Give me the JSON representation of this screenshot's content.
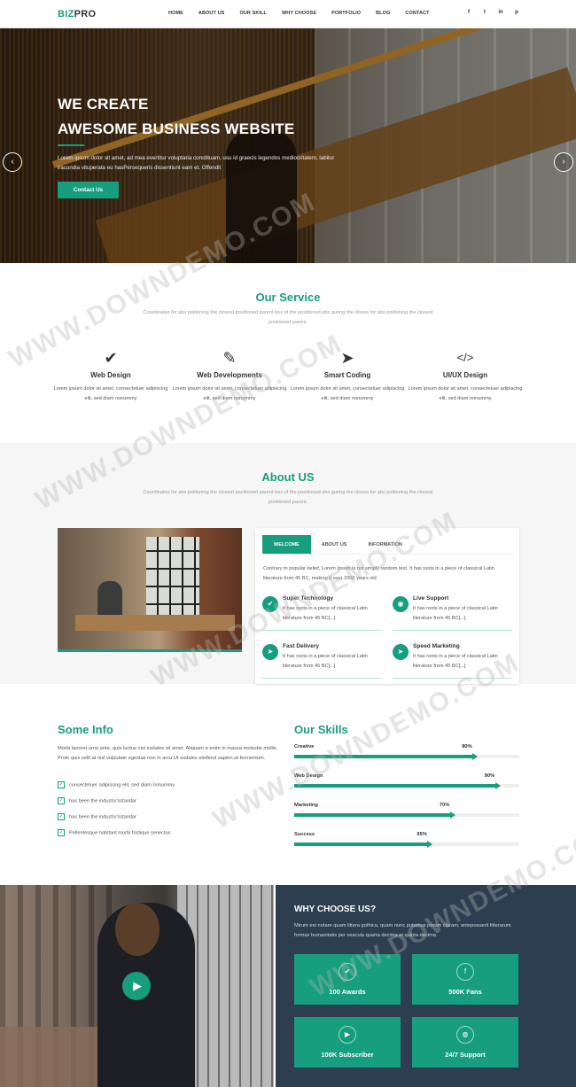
{
  "nav": {
    "logo_a": "BIZ",
    "logo_b": "PRO",
    "menu": [
      "HOME",
      "ABOUT US",
      "OUR SKILL",
      "WHY CHOOSE",
      "PORTFOLIO",
      "BLOG",
      "CONTACT"
    ],
    "social": [
      "f",
      "t",
      "in",
      "p"
    ]
  },
  "hero": {
    "line1": "WE CREATE",
    "line2": "AWESOME BUSINESS WEBSITE",
    "text": "Lorem ipsum dolor sit amet, ad mea evertitur voluptaria constituam, usu id graecis legendos mediocritatem, labitur iracundia vituperata eu hasPersequeris dissentiunt eam et. Offendit",
    "button": "Contact Us",
    "prev": "‹",
    "next": "›"
  },
  "service": {
    "title": "Our Service",
    "subtitle": "Coordinates for abs poitioning the closest positioned parent box of the positioned abs guring the closes for abs poitioning the closest positioned parent.",
    "items": [
      {
        "icon": "check-icon",
        "glyph": "✔",
        "title": "Web Design",
        "text": "Lorem ipsum dolor sit amet, consectetuer adipiscing elit, sed diam nonummy"
      },
      {
        "icon": "edit-icon",
        "glyph": "✎",
        "title": "Web Developments",
        "text": "Lorem ipsum dolor sit amet, consectetuer adipiscing elit, sed diam nonummy"
      },
      {
        "icon": "paper-plane-icon",
        "glyph": "➤",
        "title": "Smart Coding",
        "text": "Lorem ipsum dolor sit amet, consectetuer adipiscing elit, sed diam nonummy"
      },
      {
        "icon": "code-icon",
        "glyph": "</>",
        "title": "UI/UX Design",
        "text": "Lorem ipsum dolor sit amet, consectetuer adipiscing elit, sed diam nonummy"
      }
    ]
  },
  "about": {
    "title": "About US",
    "subtitle": "Coordinates for abs poitioning the closest positioned parent box of the positioned abs guring the closes for abs poitioning the closest positioned parent.",
    "tabs": [
      "WELCOME",
      "ABOUT US",
      "INFORMATION"
    ],
    "text": "Contrary to popular belief, Lorem Ipsum is not simply random text. It has roots in a piece of classical Latin literature from 45 BC, making it over 2000 years old",
    "features": [
      {
        "icon": "check-icon",
        "glyph": "✔",
        "title": "Super Technology",
        "text": "It has roots in a piece of classical Latin literature from 45 BC[...]"
      },
      {
        "icon": "support-icon",
        "glyph": "◉",
        "title": "Live Support",
        "text": "It has roots in a piece of classical Latin literature from 45 BC[...]"
      },
      {
        "icon": "paper-plane-icon",
        "glyph": "➤",
        "title": "Fast Delivery",
        "text": "It has roots in a piece of classical Latin literature from 45 BC[...]"
      },
      {
        "icon": "paper-plane-icon",
        "glyph": "➤",
        "title": "Speed Marketing",
        "text": "It has roots in a piece of classical Latin literature from 45 BC[...]"
      }
    ]
  },
  "info": {
    "title": "Some Info",
    "text": "Morbi laoreet urna ante, quis luctus nisi sodales sit amet. Aliquam a enim in massa molestie mollis. Proin quis velit at nisl vulputate egestas non in arcu.Ut sodales eleifend sapien at fermentum.",
    "checks": [
      "consectetuer adipiscing elit, sed diam nonummy",
      "has been the industry'sstandar",
      "has been the industry'sstandar",
      "Pellentesque habitant morbi tristique senectus"
    ]
  },
  "skills": {
    "title": "Our Skills",
    "items": [
      {
        "name": "Creative",
        "label": "80%",
        "value": 80
      },
      {
        "name": "Web Design",
        "label": "90%",
        "value": 90
      },
      {
        "name": "Marketing",
        "label": "70%",
        "value": 70
      },
      {
        "name": "Success",
        "label": "95%",
        "value": 60
      }
    ]
  },
  "why": {
    "title": "WHY CHOOSE US?",
    "text": "Mirum est notare quam littera gothica, quam nunc putamus parum claram, anteposuerit litterarum formas humanitatis per seacula quarta decima et quinta decima.",
    "cards": [
      {
        "icon": "check-circle-icon",
        "glyph": "✔",
        "label": "100 Awards"
      },
      {
        "icon": "facebook-icon",
        "glyph": "f",
        "label": "500K Fans"
      },
      {
        "icon": "youtube-icon",
        "glyph": "▶",
        "label": "100K Subscriber"
      },
      {
        "icon": "globe-icon",
        "glyph": "◍",
        "label": "24/7 Support"
      }
    ]
  },
  "video": {
    "play": "▶"
  },
  "watermark": "WWW.DOWNDEMO.COM",
  "colors": {
    "accent": "#179e7e",
    "dark": "#2c3e50"
  }
}
